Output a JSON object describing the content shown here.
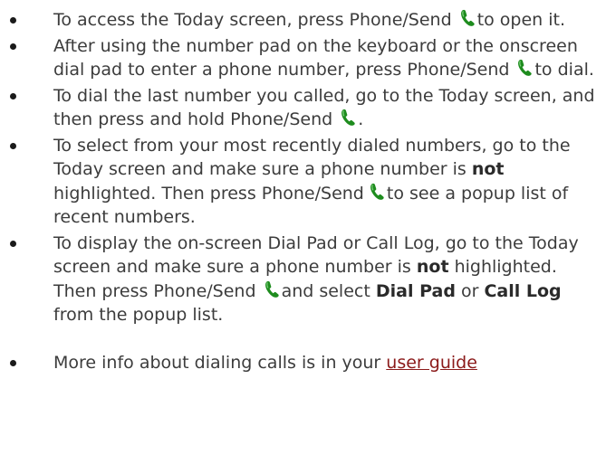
{
  "tips": [
    {
      "parts": {
        "a": "To access the Today screen, press Phone/Send ",
        "b": "to open it."
      }
    },
    {
      "parts": {
        "a": "After using the number pad on the keyboard or the onscreen dial pad to enter a phone number, press Phone/Send ",
        "b": "to dial."
      }
    },
    {
      "parts": {
        "a": "To dial the last number you called, go to the Today screen, and then press and hold Phone/Send ",
        "b": "."
      }
    },
    {
      "parts": {
        "a": "To select from your most recently dialed numbers, go to the Today screen and make sure a phone number is ",
        "bold1": "not",
        "b": " highlighted. Then press Phone/Send ",
        "c": "to see a popup list of recent numbers."
      }
    },
    {
      "parts": {
        "a": "To display the on-screen Dial Pad or Call Log, go to the Today screen and make sure a phone number is ",
        "bold1": "not",
        "b": " highlighted. Then press Phone/Send ",
        "c": "and select ",
        "bold2": "Dial Pad",
        "d": " or ",
        "bold3": "Call Log",
        "e": " from the popup list."
      }
    },
    {
      "parts": {
        "a": "More info about dialing calls is in your ",
        "link": "user guide"
      }
    }
  ],
  "icons": {
    "phone": "phone-send-icon",
    "phone_color": "#1e8c1e",
    "link_color": "#8b1a1a"
  }
}
